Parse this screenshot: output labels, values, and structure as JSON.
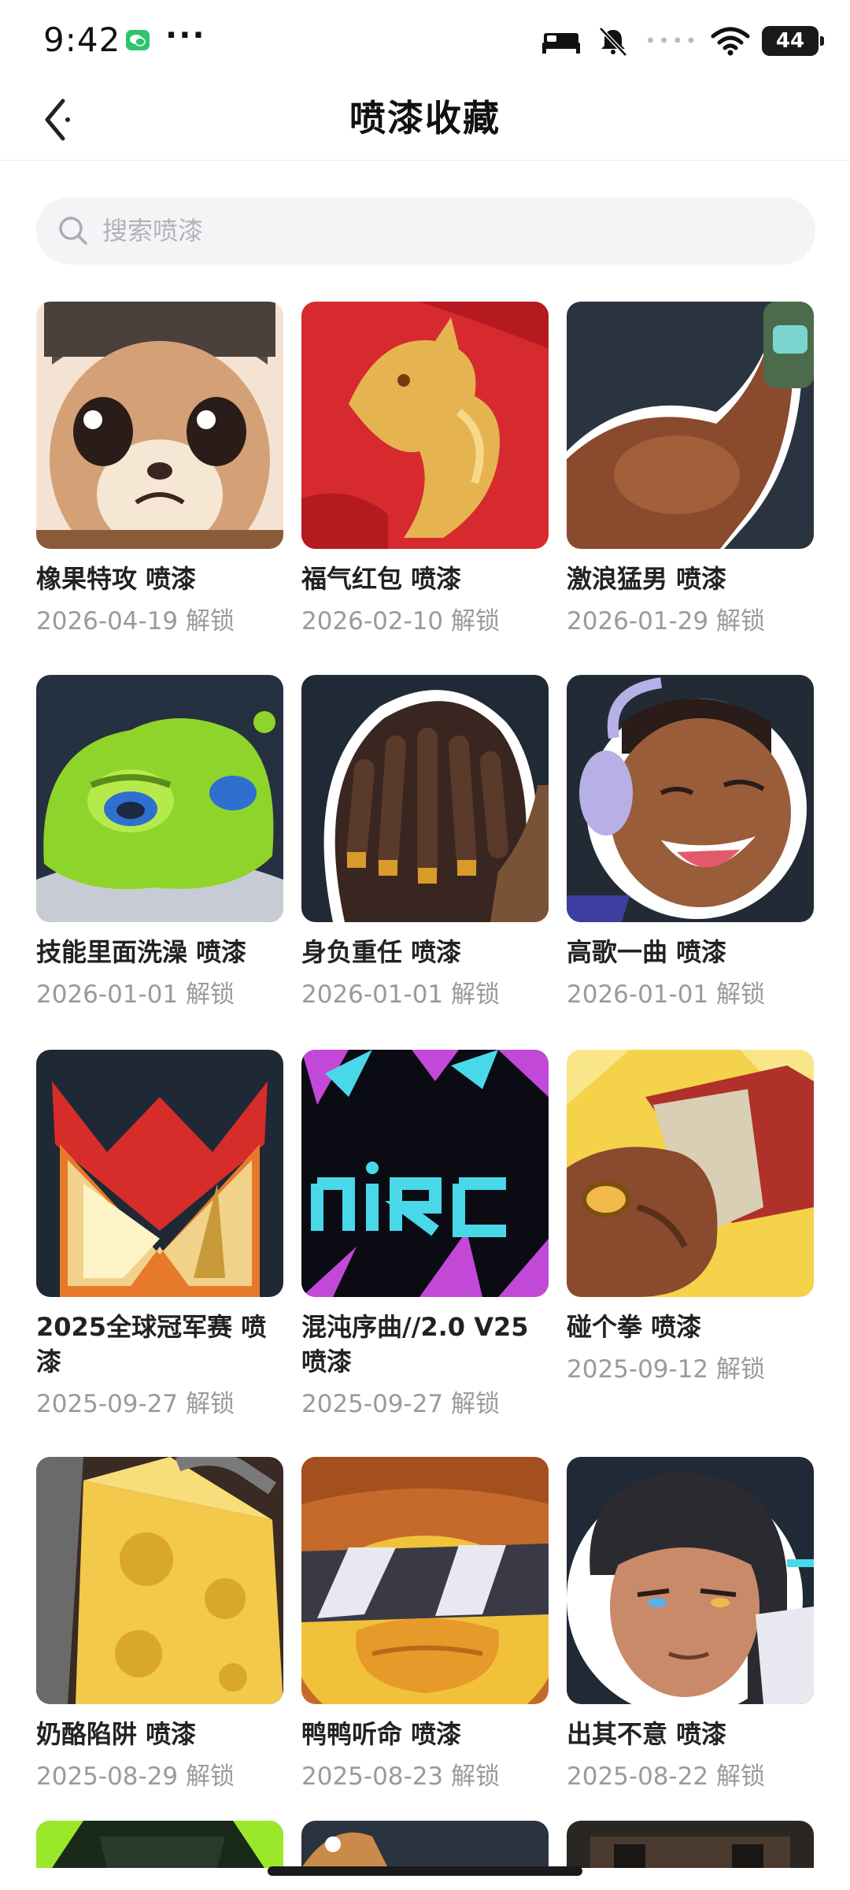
{
  "status_bar": {
    "time": "9:42",
    "more": "···",
    "battery": "44",
    "signal_dots": "••••",
    "icons": [
      "wechat-icon",
      "bed-icon",
      "bell-off-icon",
      "wifi-icon",
      "battery-icon"
    ]
  },
  "header": {
    "title": "喷漆收藏",
    "back_icon": "chevron-left-icon"
  },
  "search": {
    "placeholder": "搜索喷漆",
    "value": ""
  },
  "cards": [
    {
      "title": "橡果特攻 喷漆",
      "date": "2026-04-19 解锁",
      "icon": "squirrel-spray"
    },
    {
      "title": "福气红包 喷漆",
      "date": "2026-02-10 解锁",
      "icon": "golden-horse-spray"
    },
    {
      "title": "激浪猛男 喷漆",
      "date": "2026-01-29 解锁",
      "icon": "flexing-arm-spray"
    },
    {
      "title": "技能里面洗澡 喷漆",
      "date": "2026-01-01 解锁",
      "icon": "green-slime-spray"
    },
    {
      "title": "身负重任 喷漆",
      "date": "2026-01-01 解锁",
      "icon": "dreadlocks-spray"
    },
    {
      "title": "高歌一曲 喷漆",
      "date": "2026-01-01 解锁",
      "icon": "singing-agent-spray"
    },
    {
      "title": "2025全球冠军赛 喷漆",
      "date": "2025-09-27 解锁",
      "icon": "champions-logo-spray"
    },
    {
      "title": "混沌序曲//2.0 V25 喷漆",
      "date": "2025-09-27 解锁",
      "icon": "neon-text-spray"
    },
    {
      "title": "碰个拳 喷漆",
      "date": "2025-09-12 解锁",
      "icon": "fist-bump-spray"
    },
    {
      "title": "奶酪陷阱 喷漆",
      "date": "2025-08-29 解锁",
      "icon": "cheese-spray"
    },
    {
      "title": "鸭鸭听命 喷漆",
      "date": "2025-08-23 解锁",
      "icon": "duck-sunglasses-spray"
    },
    {
      "title": "出其不意 喷漆",
      "date": "2025-08-22 解锁",
      "icon": "agent-portrait-spray"
    }
  ]
}
